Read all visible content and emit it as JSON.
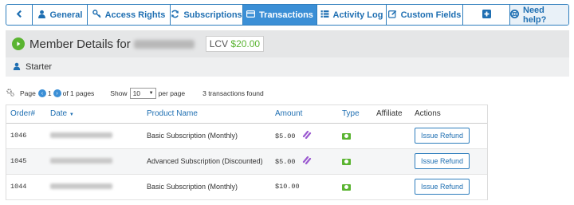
{
  "tabs": [
    {
      "label": "",
      "icon": "chevron-left-icon"
    },
    {
      "label": "General",
      "icon": "user-icon"
    },
    {
      "label": "Access Rights",
      "icon": "key-icon"
    },
    {
      "label": "Subscriptions",
      "icon": "refresh-icon"
    },
    {
      "label": "Transactions",
      "icon": "credit-card-icon",
      "active": true
    },
    {
      "label": "Activity Log",
      "icon": "list-icon"
    },
    {
      "label": "Custom Fields",
      "icon": "edit-icon"
    },
    {
      "label": "",
      "icon": "plus-square-icon"
    },
    {
      "label": "Need help?",
      "icon": "lifebuoy-icon"
    }
  ],
  "member": {
    "title_prefix": "Member Details for",
    "lcv_label": "LCV",
    "lcv_value": "$20.00",
    "level": "Starter"
  },
  "pager": {
    "page_label": "Page",
    "page_number": "1",
    "of_pages": "of 1 pages",
    "show_label": "Show",
    "show_value": "10",
    "per_page": "per page",
    "found": "3 transactions found"
  },
  "table": {
    "headers": [
      "Order#",
      "Date",
      "Product Name",
      "Amount",
      "Type",
      "Affiliate",
      "Actions"
    ],
    "rows": [
      {
        "order": "1046",
        "product": "Basic Subscription (Monthly)",
        "amount": "$5.00",
        "subscription_icon": true,
        "action": "Issue Refund"
      },
      {
        "order": "1045",
        "product": "Advanced Subscription (Discounted)",
        "amount": "$5.00",
        "subscription_icon": true,
        "action": "Issue Refund"
      },
      {
        "order": "1044",
        "product": "Basic Subscription (Monthly)",
        "amount": "$10.00",
        "subscription_icon": false,
        "action": "Issue Refund"
      }
    ]
  },
  "colors": {
    "accent": "#3b8fd6",
    "border": "#2f7ebd",
    "green": "#5ab431",
    "purple": "#9b59d0"
  }
}
